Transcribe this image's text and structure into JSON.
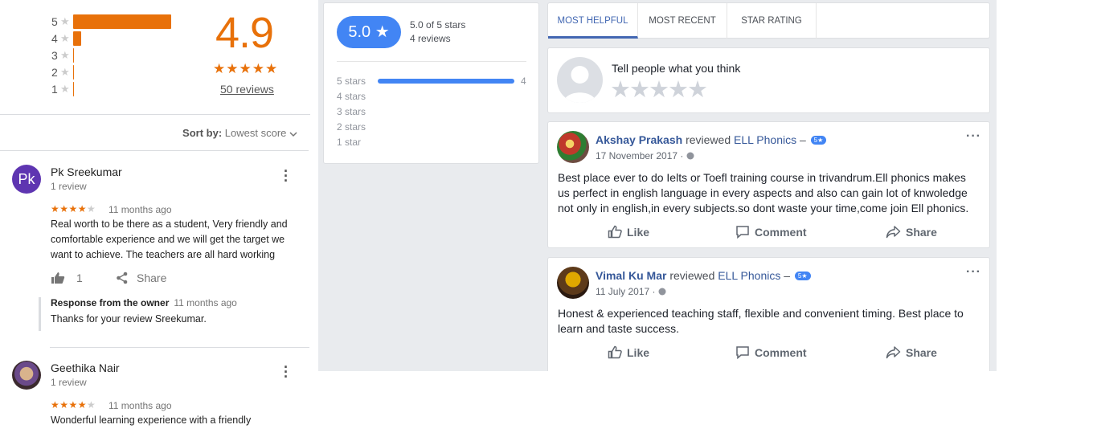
{
  "google": {
    "histogram": [
      {
        "stars": "5",
        "fraction": 1.0
      },
      {
        "stars": "4",
        "fraction": 0.08
      },
      {
        "stars": "3",
        "fraction": 0.0
      },
      {
        "stars": "2",
        "fraction": 0.0
      },
      {
        "stars": "1",
        "fraction": 0.0
      }
    ],
    "star_glyph": "★",
    "score": "4.9",
    "score_stars": "★★★★★",
    "review_count": "50 reviews",
    "sort_label": "Sort by:",
    "sort_value": "Lowest score",
    "reviews": [
      {
        "initials": "Pk",
        "name": "Pk Sreekumar",
        "sub": "1 review",
        "stars_on": "★★★★",
        "stars_off": "★",
        "time": "11 months ago",
        "text": "Real worth to be there as a student, Very friendly and comfortable experience and we will get the target we want to achieve. The teachers are all hard working",
        "likes": "1",
        "share": "Share",
        "response_title": "Response from the owner",
        "response_time": "11 months ago",
        "response_text": "Thanks for your review Sreekumar."
      },
      {
        "name": "Geethika Nair",
        "sub": "1 review",
        "stars_on": "★★★★",
        "stars_off": "★",
        "time": "11 months ago",
        "text": "Wonderful learning experience with a friendly"
      }
    ]
  },
  "facebook": {
    "summary": {
      "score": "5.0 ★",
      "line1": "5.0 of 5 stars",
      "line2": "4 reviews",
      "rows": [
        {
          "label": "5 stars",
          "fraction": 1.0,
          "count": "4"
        },
        {
          "label": "4 stars",
          "fraction": 0.0,
          "count": ""
        },
        {
          "label": "3 stars",
          "fraction": 0.0,
          "count": ""
        },
        {
          "label": "2 stars",
          "fraction": 0.0,
          "count": ""
        },
        {
          "label": "1 star",
          "fraction": 0.0,
          "count": ""
        }
      ]
    },
    "tabs": [
      "MOST HELPFUL",
      "MOST RECENT",
      "STAR RATING"
    ],
    "write_prompt": "Tell people what you think",
    "write_stars": "★★★★★",
    "posts": [
      {
        "author": "Akshay Prakash",
        "verb": "reviewed",
        "page": "ELL Phonics",
        "dash": "–",
        "badge": "5★",
        "date": "17 November 2017 ·",
        "body": "Best place ever to do Ielts or Toefl training course in trivandrum.Ell phonics makes us perfect in english language in every aspects and also can gain lot of knwoledge not only in english,in every subjects.so dont waste your time,come join Ell phonics.",
        "like": "Like",
        "comment": "Comment",
        "share": "Share"
      },
      {
        "author": "Vimal Ku Mar",
        "verb": "reviewed",
        "page": "ELL Phonics",
        "dash": "–",
        "badge": "5★",
        "date": "11 July 2017 ·",
        "body": "Honest & experienced teaching staff, flexible and convenient timing. Best place to learn and taste success.",
        "like": "Like",
        "comment": "Comment",
        "share": "Share"
      }
    ]
  }
}
